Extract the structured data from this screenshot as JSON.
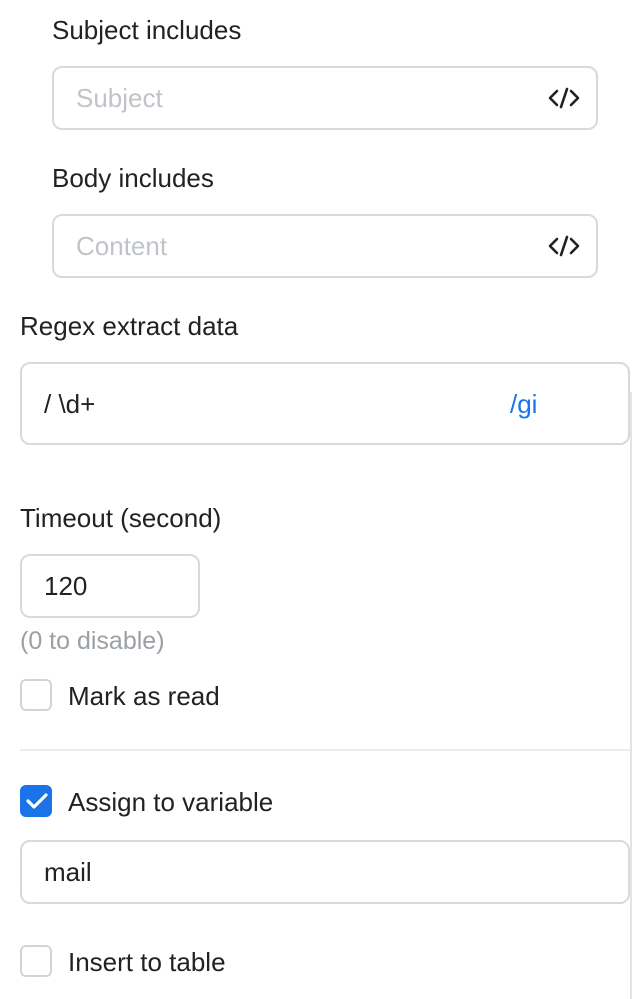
{
  "subject": {
    "label": "Subject includes",
    "placeholder": "Subject",
    "code_icon": "code-icon"
  },
  "body": {
    "label": "Body includes",
    "placeholder": "Content",
    "code_icon": "code-icon"
  },
  "regex": {
    "label": "Regex extract data",
    "value": "/ \\d+",
    "flags": "/gi"
  },
  "timeout": {
    "label": "Timeout (second)",
    "value": "120",
    "hint": "(0 to disable)"
  },
  "mark_as_read": {
    "label": "Mark as read",
    "checked": false
  },
  "assign_to_variable": {
    "label": "Assign to variable",
    "checked": true,
    "value": "mail"
  },
  "insert_to_table": {
    "label": "Insert to table",
    "checked": false
  },
  "colors": {
    "accent": "#1a73e8",
    "border": "#d9d9d9",
    "placeholder": "#c0c4c9",
    "hint": "#9aa0a6"
  }
}
